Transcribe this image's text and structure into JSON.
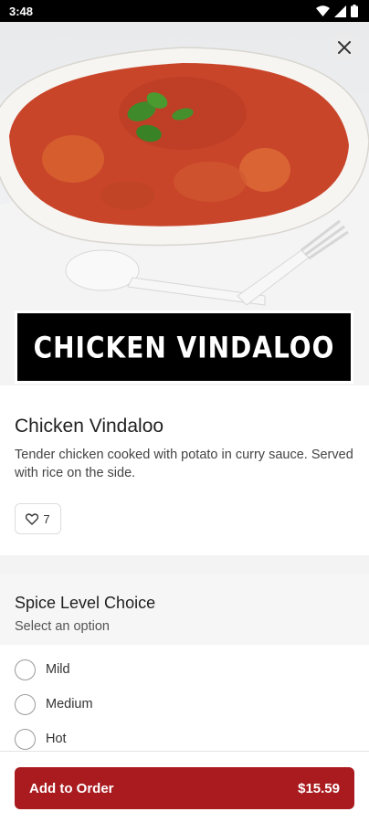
{
  "status_bar": {
    "time": "3:48",
    "icons": [
      "wifi-icon",
      "signal-icon",
      "battery-icon"
    ]
  },
  "hero": {
    "banner_text": "CHICKEN  VINDALOO",
    "close_icon": "close-icon"
  },
  "item": {
    "title": "Chicken Vindaloo",
    "description": "Tender chicken cooked with potato in curry sauce. Served with rice on the side.",
    "likes": "7",
    "like_icon": "heart-icon"
  },
  "spice_level": {
    "title": "Spice Level Choice",
    "subtitle": "Select an option",
    "options": [
      "Mild",
      "Medium",
      "Hot"
    ]
  },
  "footer": {
    "button_label": "Add to Order",
    "price": "$15.59"
  },
  "colors": {
    "accent": "#a91b1f",
    "status_bar": "#000000",
    "curry": "#c9452a"
  }
}
